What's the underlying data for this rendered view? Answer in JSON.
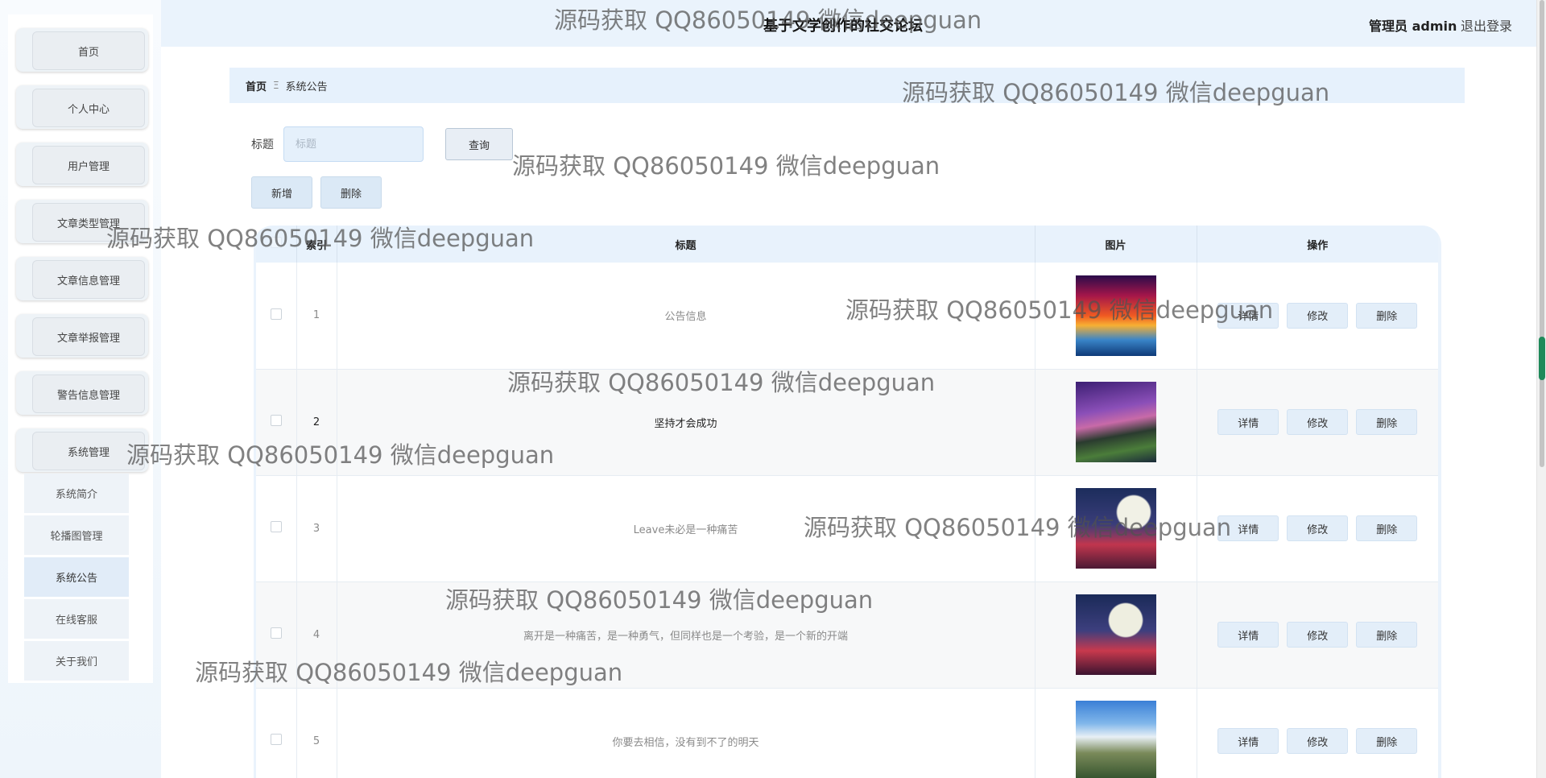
{
  "header": {
    "site_title": "基于文学创作的社交论坛",
    "user_label": "管理员 admin",
    "logout_label": "退出登录"
  },
  "sidebar": {
    "items": [
      {
        "label": "首页"
      },
      {
        "label": "个人中心"
      },
      {
        "label": "用户管理"
      },
      {
        "label": "文章类型管理"
      },
      {
        "label": "文章信息管理"
      },
      {
        "label": "文章举报管理"
      },
      {
        "label": "警告信息管理"
      },
      {
        "label": "系统管理"
      }
    ],
    "submenu": [
      {
        "label": "系统简介"
      },
      {
        "label": "轮播图管理"
      },
      {
        "label": "系统公告",
        "active": true
      },
      {
        "label": "在线客服"
      },
      {
        "label": "关于我们"
      }
    ]
  },
  "breadcrumb": {
    "home": "首页",
    "separator": "Ξ",
    "current": "系统公告"
  },
  "search": {
    "label": "标题",
    "placeholder": "标题",
    "query_button": "查询"
  },
  "actions": {
    "add_button": "新增",
    "delete_button": "删除"
  },
  "table": {
    "columns": [
      "",
      "索引",
      "标题",
      "图片",
      "操作"
    ],
    "rows": [
      {
        "index": "1",
        "title": "公告信息"
      },
      {
        "index": "2",
        "title": "坚持才会成功"
      },
      {
        "index": "3",
        "title": "Leave未必是一种痛苦"
      },
      {
        "index": "4",
        "title": "离开是一种痛苦，是一种勇气，但同样也是一个考验，是一个新的开端"
      },
      {
        "index": "5",
        "title": "你要去相信，没有到不了的明天"
      }
    ],
    "row_actions": {
      "detail": "详情",
      "edit": "修改",
      "delete": "删除"
    }
  },
  "watermark": "源码获取 QQ86050149 微信deepguan"
}
